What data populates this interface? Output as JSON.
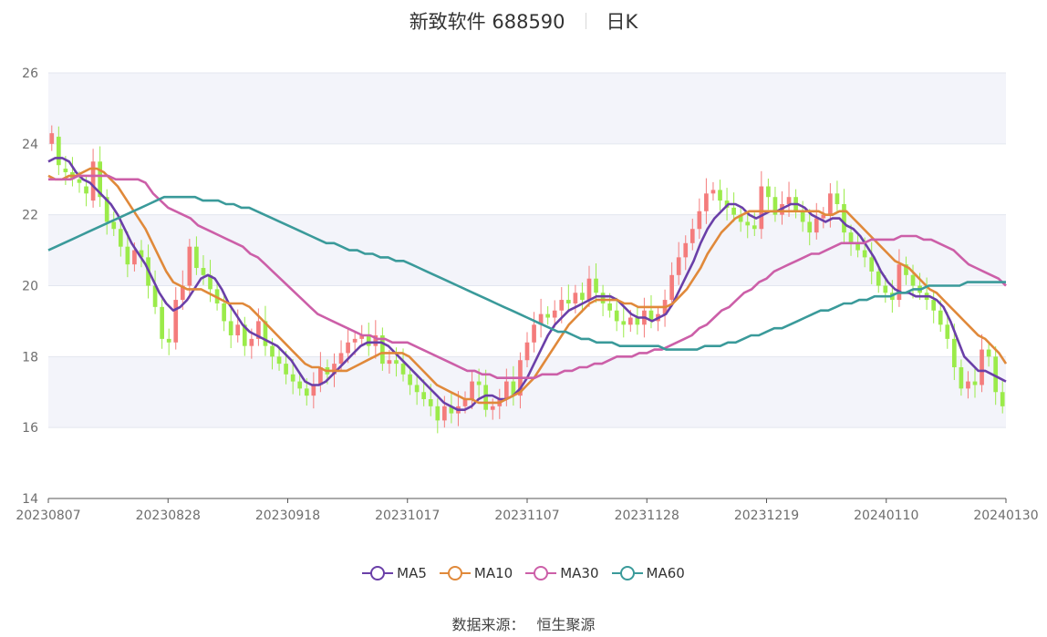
{
  "header": {
    "title": "新致软件 688590",
    "period": "日K"
  },
  "source": {
    "label": "数据来源：",
    "value": "恒生聚源"
  },
  "chart_data": {
    "type": "candlestick",
    "title": "新致软件 688590",
    "ylim": [
      14,
      26
    ],
    "y_ticks": [
      14,
      16,
      18,
      20,
      22,
      24,
      26
    ],
    "x_ticks": [
      "20230807",
      "20230828",
      "20230918",
      "20231017",
      "20231107",
      "20231128",
      "20231219",
      "20240110",
      "20240130"
    ],
    "x_range": [
      "20230807",
      "20240130"
    ],
    "grid": true,
    "legend_position": "bottom-center",
    "colors": {
      "up": "#f47c7c",
      "down": "#9beb4a",
      "band": "#f3f4fa",
      "gridline": "#e3e6ef"
    },
    "close": [
      24.3,
      23.4,
      23.2,
      23.0,
      22.9,
      22.6,
      23.5,
      22.5,
      21.8,
      21.6,
      21.1,
      20.6,
      21.0,
      20.8,
      20.0,
      19.4,
      18.5,
      18.4,
      19.6,
      20.0,
      21.1,
      20.5,
      20.3,
      19.9,
      19.5,
      19.0,
      18.6,
      18.9,
      18.3,
      18.5,
      19.0,
      18.3,
      18.0,
      17.8,
      17.5,
      17.3,
      17.1,
      16.9,
      17.2,
      17.7,
      17.5,
      17.8,
      18.1,
      18.4,
      18.5,
      18.6,
      18.3,
      18.6,
      17.8,
      17.9,
      17.8,
      17.5,
      17.2,
      17.0,
      16.8,
      16.6,
      16.2,
      16.6,
      16.4,
      16.6,
      16.8,
      17.3,
      17.2,
      16.5,
      16.6,
      16.8,
      17.3,
      16.9,
      17.9,
      18.4,
      18.9,
      19.2,
      19.1,
      19.3,
      19.6,
      19.5,
      19.8,
      19.6,
      20.2,
      19.8,
      19.5,
      19.3,
      19.0,
      18.9,
      19.1,
      18.9,
      19.3,
      19.0,
      19.2,
      19.6,
      20.3,
      20.8,
      21.2,
      21.6,
      22.1,
      22.6,
      22.7,
      22.4,
      22.2,
      22.0,
      21.8,
      21.7,
      21.6,
      22.8,
      22.5,
      22.0,
      22.3,
      22.5,
      22.1,
      21.8,
      21.5,
      21.9,
      22.0,
      22.6,
      22.3,
      21.5,
      21.2,
      21.0,
      20.8,
      20.4,
      20.0,
      19.8,
      19.6,
      20.6,
      20.3,
      20.0,
      19.8,
      19.6,
      19.3,
      18.9,
      18.5,
      17.7,
      17.1,
      17.3,
      17.2,
      18.2,
      18.0,
      17.0,
      16.6
    ],
    "open": [
      24.0,
      24.2,
      23.3,
      23.2,
      23.0,
      22.8,
      22.4,
      23.5,
      22.5,
      21.8,
      21.6,
      21.1,
      20.6,
      21.0,
      20.8,
      20.0,
      19.4,
      18.5,
      18.4,
      19.6,
      20.0,
      21.1,
      20.5,
      20.3,
      19.9,
      19.5,
      19.0,
      18.6,
      18.9,
      18.3,
      18.5,
      19.0,
      18.3,
      18.0,
      17.8,
      17.5,
      17.3,
      17.1,
      16.9,
      17.2,
      17.7,
      17.5,
      17.8,
      18.1,
      18.4,
      18.5,
      18.6,
      18.3,
      18.6,
      17.8,
      17.9,
      17.8,
      17.5,
      17.2,
      17.0,
      16.8,
      16.6,
      16.2,
      16.6,
      16.4,
      16.6,
      16.8,
      17.3,
      17.2,
      16.5,
      16.6,
      16.8,
      17.3,
      16.9,
      17.9,
      18.4,
      18.9,
      19.2,
      19.1,
      19.3,
      19.6,
      19.5,
      19.8,
      19.6,
      20.2,
      19.8,
      19.5,
      19.3,
      19.0,
      18.9,
      19.1,
      18.9,
      19.3,
      19.0,
      19.2,
      19.6,
      20.3,
      20.8,
      21.2,
      21.6,
      22.1,
      22.6,
      22.7,
      22.4,
      22.2,
      22.0,
      21.8,
      21.7,
      21.6,
      22.8,
      22.5,
      22.0,
      22.3,
      22.5,
      22.1,
      21.8,
      21.5,
      21.9,
      22.0,
      22.6,
      22.3,
      21.5,
      21.2,
      21.0,
      20.8,
      20.4,
      20.0,
      19.8,
      19.6,
      20.6,
      20.3,
      20.0,
      19.8,
      19.6,
      19.3,
      18.9,
      18.5,
      17.7,
      17.1,
      17.3,
      17.2,
      18.2,
      18.0,
      17.0
    ],
    "series": [
      {
        "name": "MA5",
        "color": "#6a3fa8",
        "values": [
          23.5,
          23.6,
          23.6,
          23.5,
          23.2,
          23.0,
          22.9,
          22.7,
          22.5,
          22.3,
          22.0,
          21.6,
          21.2,
          20.9,
          20.6,
          20.2,
          19.8,
          19.5,
          19.3,
          19.4,
          19.6,
          19.9,
          20.2,
          20.3,
          20.2,
          19.9,
          19.5,
          19.2,
          18.9,
          18.7,
          18.6,
          18.5,
          18.4,
          18.3,
          18.1,
          17.9,
          17.6,
          17.3,
          17.2,
          17.2,
          17.3,
          17.5,
          17.7,
          17.9,
          18.1,
          18.3,
          18.4,
          18.4,
          18.4,
          18.3,
          18.1,
          17.9,
          17.7,
          17.5,
          17.3,
          17.1,
          16.9,
          16.7,
          16.6,
          16.5,
          16.5,
          16.6,
          16.8,
          16.9,
          16.9,
          16.8,
          16.8,
          16.9,
          17.1,
          17.4,
          17.8,
          18.2,
          18.6,
          18.9,
          19.1,
          19.3,
          19.4,
          19.5,
          19.6,
          19.7,
          19.7,
          19.7,
          19.6,
          19.4,
          19.2,
          19.1,
          19.1,
          19.0,
          19.1,
          19.2,
          19.5,
          19.9,
          20.3,
          20.7,
          21.2,
          21.6,
          21.9,
          22.1,
          22.3,
          22.3,
          22.2,
          22.0,
          21.9,
          22.0,
          22.1,
          22.1,
          22.2,
          22.3,
          22.3,
          22.2,
          22.0,
          21.9,
          21.8,
          21.9,
          21.9,
          21.7,
          21.6,
          21.4,
          21.1,
          20.8,
          20.4,
          20.1,
          19.9,
          19.8,
          19.8,
          19.7,
          19.7,
          19.7,
          19.6,
          19.4,
          19.0,
          18.5,
          18.0,
          17.8,
          17.6,
          17.6,
          17.5,
          17.4,
          17.3
        ]
      },
      {
        "name": "MA10",
        "color": "#e0893a",
        "values": [
          23.1,
          23.0,
          23.0,
          23.1,
          23.1,
          23.2,
          23.3,
          23.3,
          23.2,
          23.0,
          22.8,
          22.5,
          22.2,
          21.9,
          21.6,
          21.2,
          20.8,
          20.4,
          20.1,
          20.0,
          19.9,
          19.9,
          19.9,
          19.8,
          19.7,
          19.6,
          19.5,
          19.5,
          19.5,
          19.4,
          19.2,
          19.0,
          18.8,
          18.6,
          18.4,
          18.2,
          18.0,
          17.8,
          17.7,
          17.7,
          17.6,
          17.6,
          17.6,
          17.6,
          17.7,
          17.8,
          17.9,
          18.0,
          18.1,
          18.1,
          18.1,
          18.1,
          18.0,
          17.8,
          17.6,
          17.4,
          17.2,
          17.1,
          17.0,
          16.9,
          16.8,
          16.8,
          16.7,
          16.7,
          16.7,
          16.7,
          16.8,
          16.9,
          17.0,
          17.2,
          17.4,
          17.7,
          18.0,
          18.3,
          18.6,
          18.9,
          19.1,
          19.3,
          19.5,
          19.6,
          19.6,
          19.6,
          19.6,
          19.5,
          19.5,
          19.4,
          19.4,
          19.4,
          19.4,
          19.4,
          19.5,
          19.7,
          19.9,
          20.2,
          20.5,
          20.9,
          21.2,
          21.5,
          21.7,
          21.9,
          22.0,
          22.1,
          22.1,
          22.1,
          22.1,
          22.1,
          22.1,
          22.1,
          22.1,
          22.1,
          22.1,
          22.1,
          22.0,
          22.0,
          22.1,
          22.1,
          21.9,
          21.7,
          21.5,
          21.3,
          21.1,
          20.9,
          20.7,
          20.6,
          20.5,
          20.3,
          20.1,
          19.9,
          19.8,
          19.6,
          19.4,
          19.2,
          19.0,
          18.8,
          18.6,
          18.5,
          18.3,
          18.1,
          17.8
        ]
      },
      {
        "name": "MA30",
        "color": "#cc5fa8",
        "values": [
          23.0,
          23.0,
          23.0,
          23.0,
          23.1,
          23.1,
          23.1,
          23.1,
          23.1,
          23.0,
          23.0,
          23.0,
          23.0,
          22.9,
          22.6,
          22.4,
          22.2,
          22.1,
          22.0,
          21.9,
          21.7,
          21.6,
          21.5,
          21.4,
          21.3,
          21.2,
          21.1,
          20.9,
          20.8,
          20.6,
          20.4,
          20.2,
          20.0,
          19.8,
          19.6,
          19.4,
          19.2,
          19.1,
          19.0,
          18.9,
          18.8,
          18.7,
          18.6,
          18.6,
          18.5,
          18.5,
          18.4,
          18.4,
          18.4,
          18.3,
          18.2,
          18.1,
          18.0,
          17.9,
          17.8,
          17.7,
          17.6,
          17.6,
          17.5,
          17.5,
          17.4,
          17.4,
          17.4,
          17.4,
          17.4,
          17.4,
          17.5,
          17.5,
          17.5,
          17.6,
          17.6,
          17.7,
          17.7,
          17.8,
          17.8,
          17.9,
          18.0,
          18.0,
          18.0,
          18.1,
          18.1,
          18.2,
          18.2,
          18.3,
          18.4,
          18.5,
          18.6,
          18.8,
          18.9,
          19.1,
          19.3,
          19.4,
          19.6,
          19.8,
          19.9,
          20.1,
          20.2,
          20.4,
          20.5,
          20.6,
          20.7,
          20.8,
          20.9,
          20.9,
          21.0,
          21.1,
          21.2,
          21.2,
          21.2,
          21.2,
          21.3,
          21.3,
          21.3,
          21.3,
          21.4,
          21.4,
          21.4,
          21.3,
          21.3,
          21.2,
          21.1,
          21.0,
          20.8,
          20.6,
          20.5,
          20.4,
          20.3,
          20.2,
          20.0
        ]
      },
      {
        "name": "MA60",
        "color": "#3a9a9a",
        "values": [
          21.0,
          21.1,
          21.2,
          21.3,
          21.4,
          21.5,
          21.6,
          21.7,
          21.8,
          21.9,
          22.0,
          22.1,
          22.2,
          22.3,
          22.4,
          22.5,
          22.5,
          22.5,
          22.5,
          22.5,
          22.4,
          22.4,
          22.4,
          22.3,
          22.3,
          22.2,
          22.2,
          22.1,
          22.0,
          21.9,
          21.8,
          21.7,
          21.6,
          21.5,
          21.4,
          21.3,
          21.2,
          21.2,
          21.1,
          21.0,
          21.0,
          20.9,
          20.9,
          20.8,
          20.8,
          20.7,
          20.7,
          20.6,
          20.5,
          20.4,
          20.3,
          20.2,
          20.1,
          20.0,
          19.9,
          19.8,
          19.7,
          19.6,
          19.5,
          19.4,
          19.3,
          19.2,
          19.1,
          19.0,
          18.9,
          18.8,
          18.7,
          18.7,
          18.6,
          18.5,
          18.5,
          18.4,
          18.4,
          18.4,
          18.3,
          18.3,
          18.3,
          18.3,
          18.3,
          18.3,
          18.2,
          18.2,
          18.2,
          18.2,
          18.2,
          18.3,
          18.3,
          18.3,
          18.4,
          18.4,
          18.5,
          18.6,
          18.6,
          18.7,
          18.8,
          18.8,
          18.9,
          19.0,
          19.1,
          19.2,
          19.3,
          19.3,
          19.4,
          19.5,
          19.5,
          19.6,
          19.6,
          19.7,
          19.7,
          19.7,
          19.8,
          19.8,
          19.9,
          19.9,
          20.0,
          20.0,
          20.0,
          20.0,
          20.0,
          20.1,
          20.1,
          20.1,
          20.1,
          20.1,
          20.1
        ]
      }
    ]
  }
}
